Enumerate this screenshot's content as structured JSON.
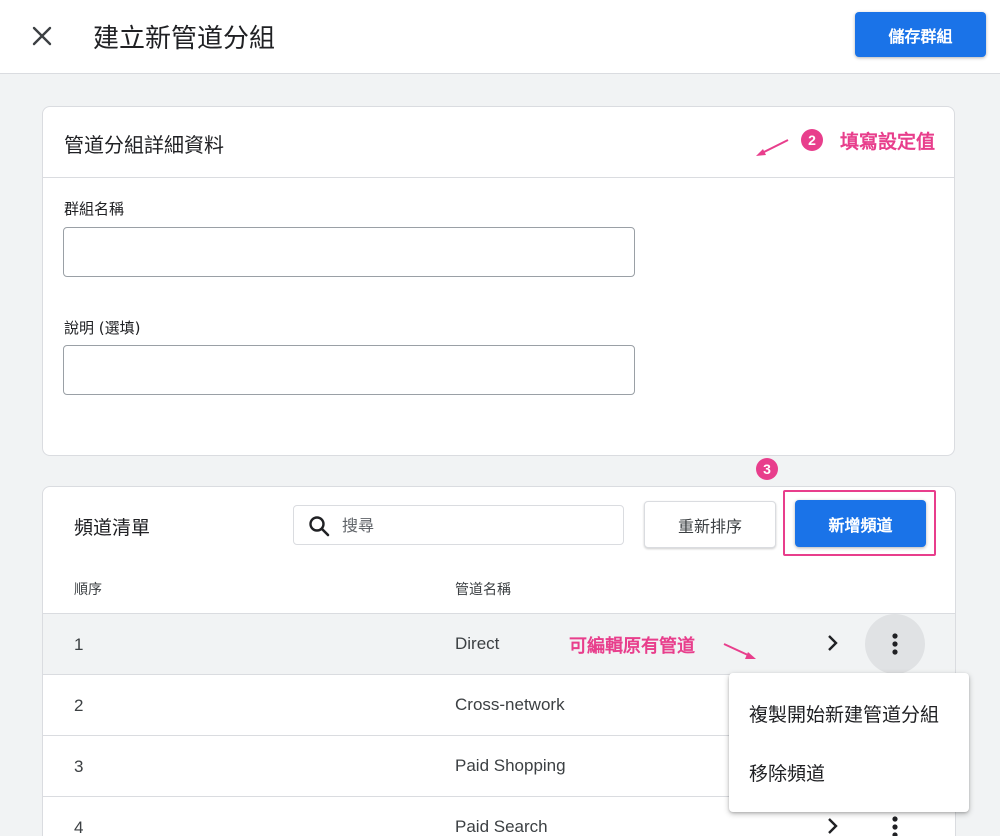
{
  "header": {
    "title": "建立新管道分組",
    "save_label": "儲存群組"
  },
  "details": {
    "title": "管道分組詳細資料",
    "name_label": "群組名稱",
    "name_value": "",
    "description_label": "說明 (選填)",
    "description_value": ""
  },
  "annotations": {
    "step2_number": "2",
    "step2_text": "填寫設定值",
    "step3_number": "3",
    "edit_hint": "可編輯原有管道"
  },
  "channel_list": {
    "title": "頻道清單",
    "search_placeholder": "搜尋",
    "reorder_label": "重新排序",
    "add_label": "新增頻道",
    "columns": {
      "order": "順序",
      "name": "管道名稱"
    },
    "rows": [
      {
        "order": "1",
        "name": "Direct"
      },
      {
        "order": "2",
        "name": "Cross-network"
      },
      {
        "order": "3",
        "name": "Paid Shopping"
      },
      {
        "order": "4",
        "name": "Paid Search"
      }
    ]
  },
  "context_menu": {
    "items": [
      {
        "label": "複製開始新建管道分組"
      },
      {
        "label": "移除頻道"
      }
    ]
  },
  "icons": {
    "close": "close-icon",
    "search": "search-icon",
    "chevron": "chevron-right-icon",
    "more": "more-vert-icon"
  },
  "colors": {
    "primary": "#1a73e8",
    "annotation": "#e83e8c"
  }
}
